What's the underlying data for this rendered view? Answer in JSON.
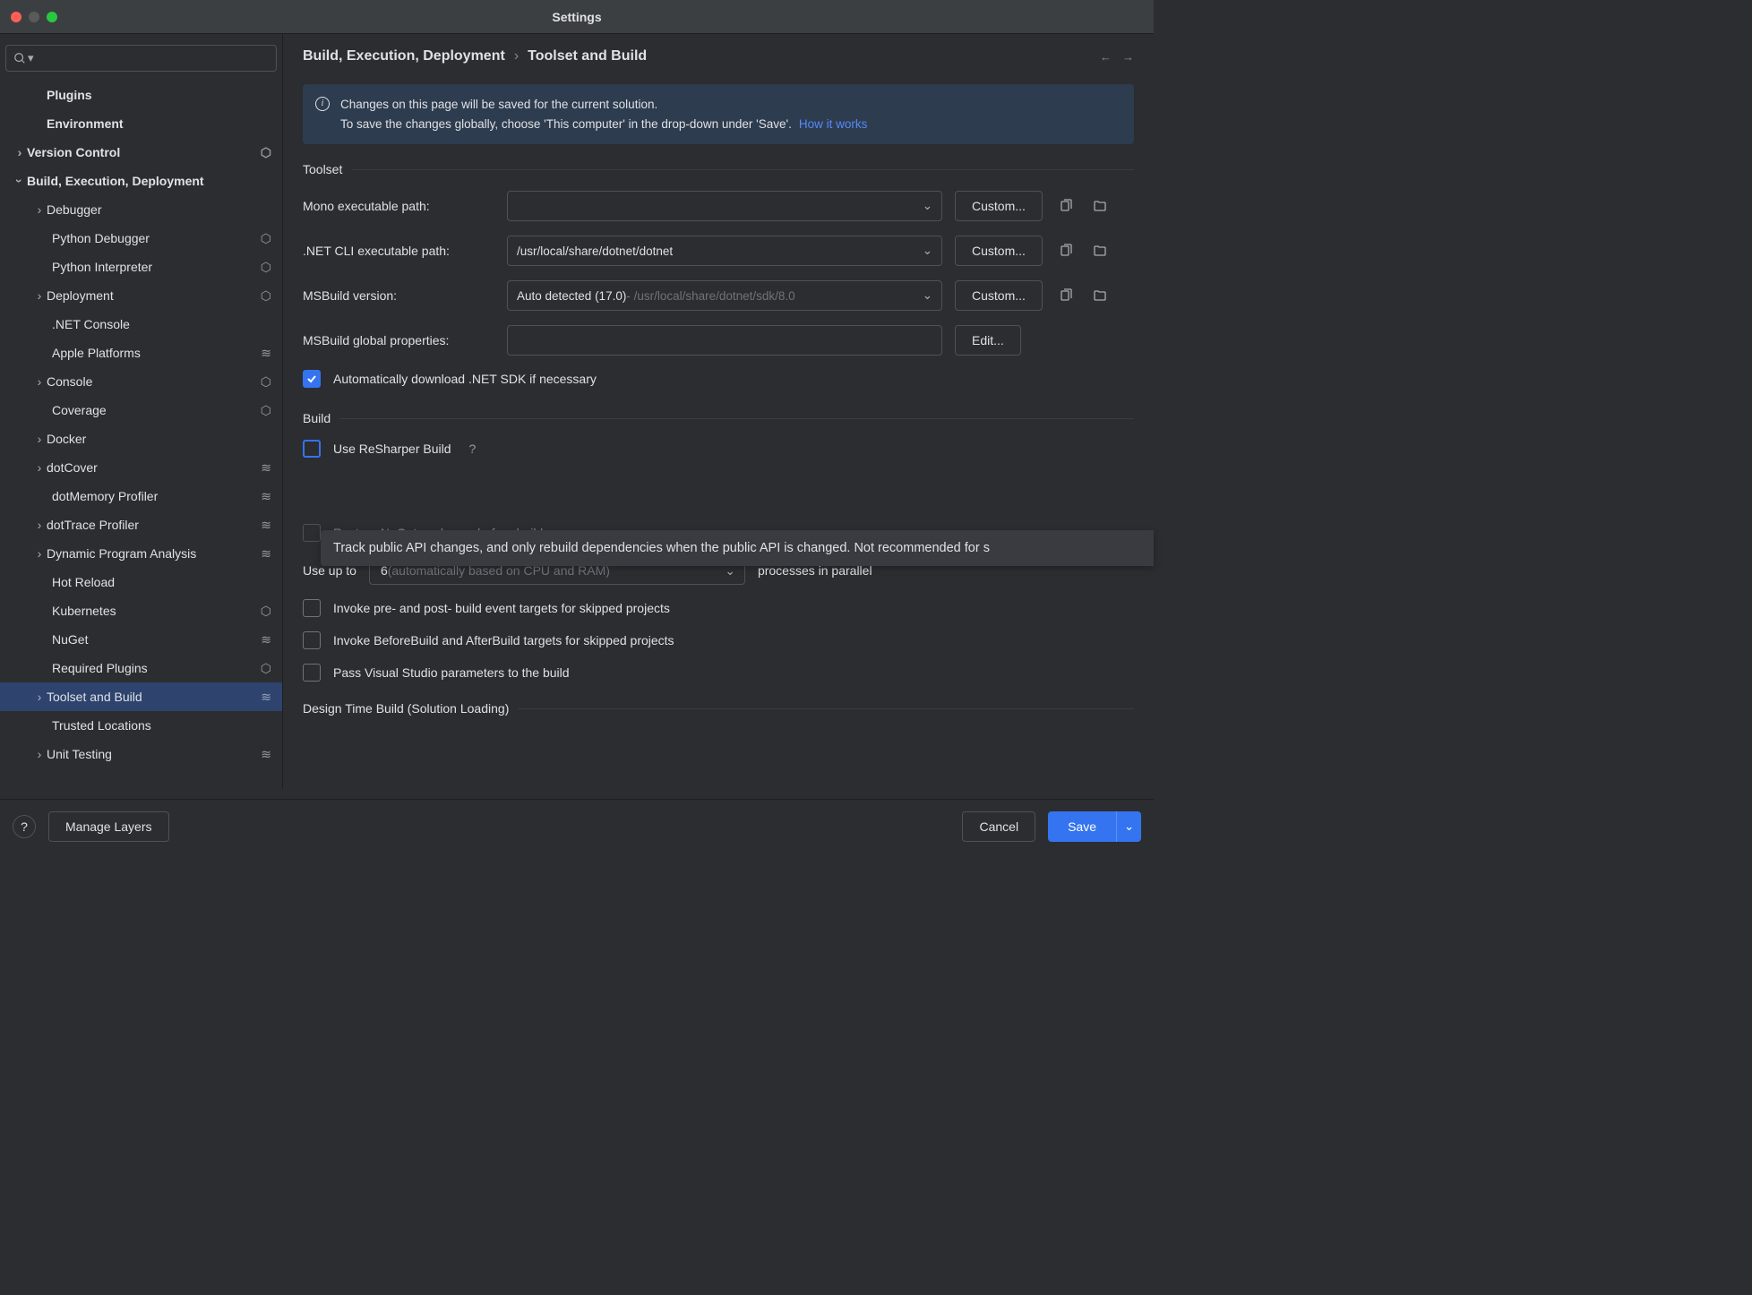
{
  "window": {
    "title": "Settings"
  },
  "breadcrumb": {
    "root": "Build, Execution, Deployment",
    "current": "Toolset and Build"
  },
  "sidebar": {
    "items": [
      {
        "label": "Plugins"
      },
      {
        "label": "Environment"
      },
      {
        "label": "Version Control"
      },
      {
        "label": "Build, Execution, Deployment"
      },
      {
        "label": "Debugger"
      },
      {
        "label": "Python Debugger"
      },
      {
        "label": "Python Interpreter"
      },
      {
        "label": "Deployment"
      },
      {
        "label": ".NET Console"
      },
      {
        "label": "Apple Platforms"
      },
      {
        "label": "Console"
      },
      {
        "label": "Coverage"
      },
      {
        "label": "Docker"
      },
      {
        "label": "dotCover"
      },
      {
        "label": "dotMemory Profiler"
      },
      {
        "label": "dotTrace Profiler"
      },
      {
        "label": "Dynamic Program Analysis"
      },
      {
        "label": "Hot Reload"
      },
      {
        "label": "Kubernetes"
      },
      {
        "label": "NuGet"
      },
      {
        "label": "Required Plugins"
      },
      {
        "label": "Toolset and Build"
      },
      {
        "label": "Trusted Locations"
      },
      {
        "label": "Unit Testing"
      }
    ]
  },
  "banner": {
    "line1": "Changes on this page will be saved for the current solution.",
    "line2": "To save the changes globally, choose 'This computer' in the drop-down under 'Save'.",
    "link": "How it works"
  },
  "sections": {
    "toolset": "Toolset",
    "build": "Build",
    "design": "Design Time Build (Solution Loading)"
  },
  "toolset": {
    "mono_label": "Mono executable path:",
    "mono_value": "",
    "netcli_label": ".NET CLI executable path:",
    "netcli_value": "/usr/local/share/dotnet/dotnet",
    "msbuild_label": "MSBuild version:",
    "msbuild_value": "Auto detected (17.0)",
    "msbuild_path": " - /usr/local/share/dotnet/sdk/8.0",
    "msbuild_props_label": "MSBuild global properties:",
    "custom_btn": "Custom...",
    "edit_btn": "Edit...",
    "auto_download": "Automatically download .NET SDK if necessary"
  },
  "build": {
    "use_resharper": "Use ReSharper Build",
    "restore_nuget": "Restore NuGet packages before build",
    "use_up_to_label": "Use up to",
    "processes_count": "6",
    "processes_hint": " (automatically based on CPU and RAM)",
    "processes_suffix": "processes in parallel",
    "invoke_prepost": "Invoke pre- and post- build event targets for skipped projects",
    "invoke_beforeafter": "Invoke BeforeBuild and AfterBuild targets for skipped projects",
    "pass_vs_params": "Pass Visual Studio parameters to the build"
  },
  "tooltip": {
    "text": "Track public API changes, and only rebuild dependencies when the public API is changed. Not recommended for s"
  },
  "footer": {
    "manage_layers": "Manage Layers",
    "cancel": "Cancel",
    "save": "Save"
  }
}
